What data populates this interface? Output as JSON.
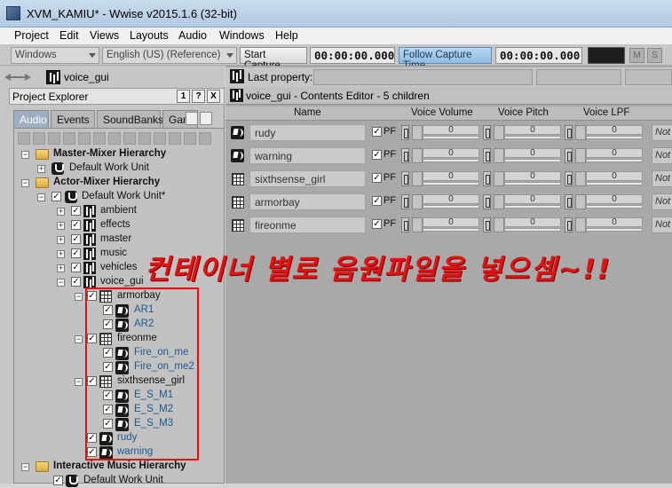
{
  "window": {
    "title": "XVM_KAMIU* - Wwise v2015.1.6 (32-bit)"
  },
  "menu": [
    "Project",
    "Edit",
    "Views",
    "Layouts",
    "Audio",
    "Windows",
    "Help"
  ],
  "toolbar": {
    "layout_combo": "Windows",
    "language_combo": "English (US) (Reference)",
    "start_capture": "Start Capture",
    "capture_time": "00:00:00.000",
    "follow_capture": "Follow Capture Time",
    "follow_time": "00:00:00.000",
    "mute_label": "M",
    "solo_label": "S"
  },
  "left_nav": {
    "path": "voice_gui"
  },
  "project_explorer": {
    "title": "Project Explorer",
    "btn_one": "1",
    "btn_help": "?",
    "btn_close": "X",
    "tabs": [
      "Audio",
      "Events",
      "SoundBanks",
      "Game"
    ]
  },
  "tree": [
    {
      "label": "Master-Mixer Hierarchy"
    },
    {
      "label": "Default Work Unit"
    },
    {
      "label": "Actor-Mixer Hierarchy"
    },
    {
      "label": "Default Work Unit*"
    },
    {
      "label": "ambient"
    },
    {
      "label": "effects"
    },
    {
      "label": "master"
    },
    {
      "label": "music"
    },
    {
      "label": "vehicles"
    },
    {
      "label": "voice_gui"
    },
    {
      "label": "armorbay"
    },
    {
      "label": "AR1"
    },
    {
      "label": "AR2"
    },
    {
      "label": "fireonme"
    },
    {
      "label": "Fire_on_me"
    },
    {
      "label": "Fire_on_me2"
    },
    {
      "label": "sixthsense_girl"
    },
    {
      "label": "E_S_M1"
    },
    {
      "label": "E_S_M2"
    },
    {
      "label": "E_S_M3"
    },
    {
      "label": "rudy"
    },
    {
      "label": "warning"
    },
    {
      "label": "Interactive Music Hierarchy"
    },
    {
      "label": "Default Work Unit"
    }
  ],
  "property_bar": {
    "label": "Last property:"
  },
  "contents_editor": {
    "title": "voice_gui - Contents Editor - 5 children",
    "columns": {
      "name": "Name",
      "voice_volume": "Voice Volume",
      "voice_pitch": "Voice Pitch",
      "voice_lpf": "Voice LPF"
    },
    "pf_label": "PF",
    "note_label": "Not",
    "rows": [
      {
        "name": "rudy",
        "volume": "0",
        "pitch": "0",
        "lpf": "0"
      },
      {
        "name": "warning",
        "volume": "0",
        "pitch": "0",
        "lpf": "0"
      },
      {
        "name": "sixthsense_girl",
        "volume": "0",
        "pitch": "0",
        "lpf": "0"
      },
      {
        "name": "armorbay",
        "volume": "0",
        "pitch": "0",
        "lpf": "0"
      },
      {
        "name": "fireonme",
        "volume": "0",
        "pitch": "0",
        "lpf": "0"
      }
    ]
  },
  "annotation": {
    "text": "컨테이너 별로 음원파일을 넣으셈~!!"
  }
}
